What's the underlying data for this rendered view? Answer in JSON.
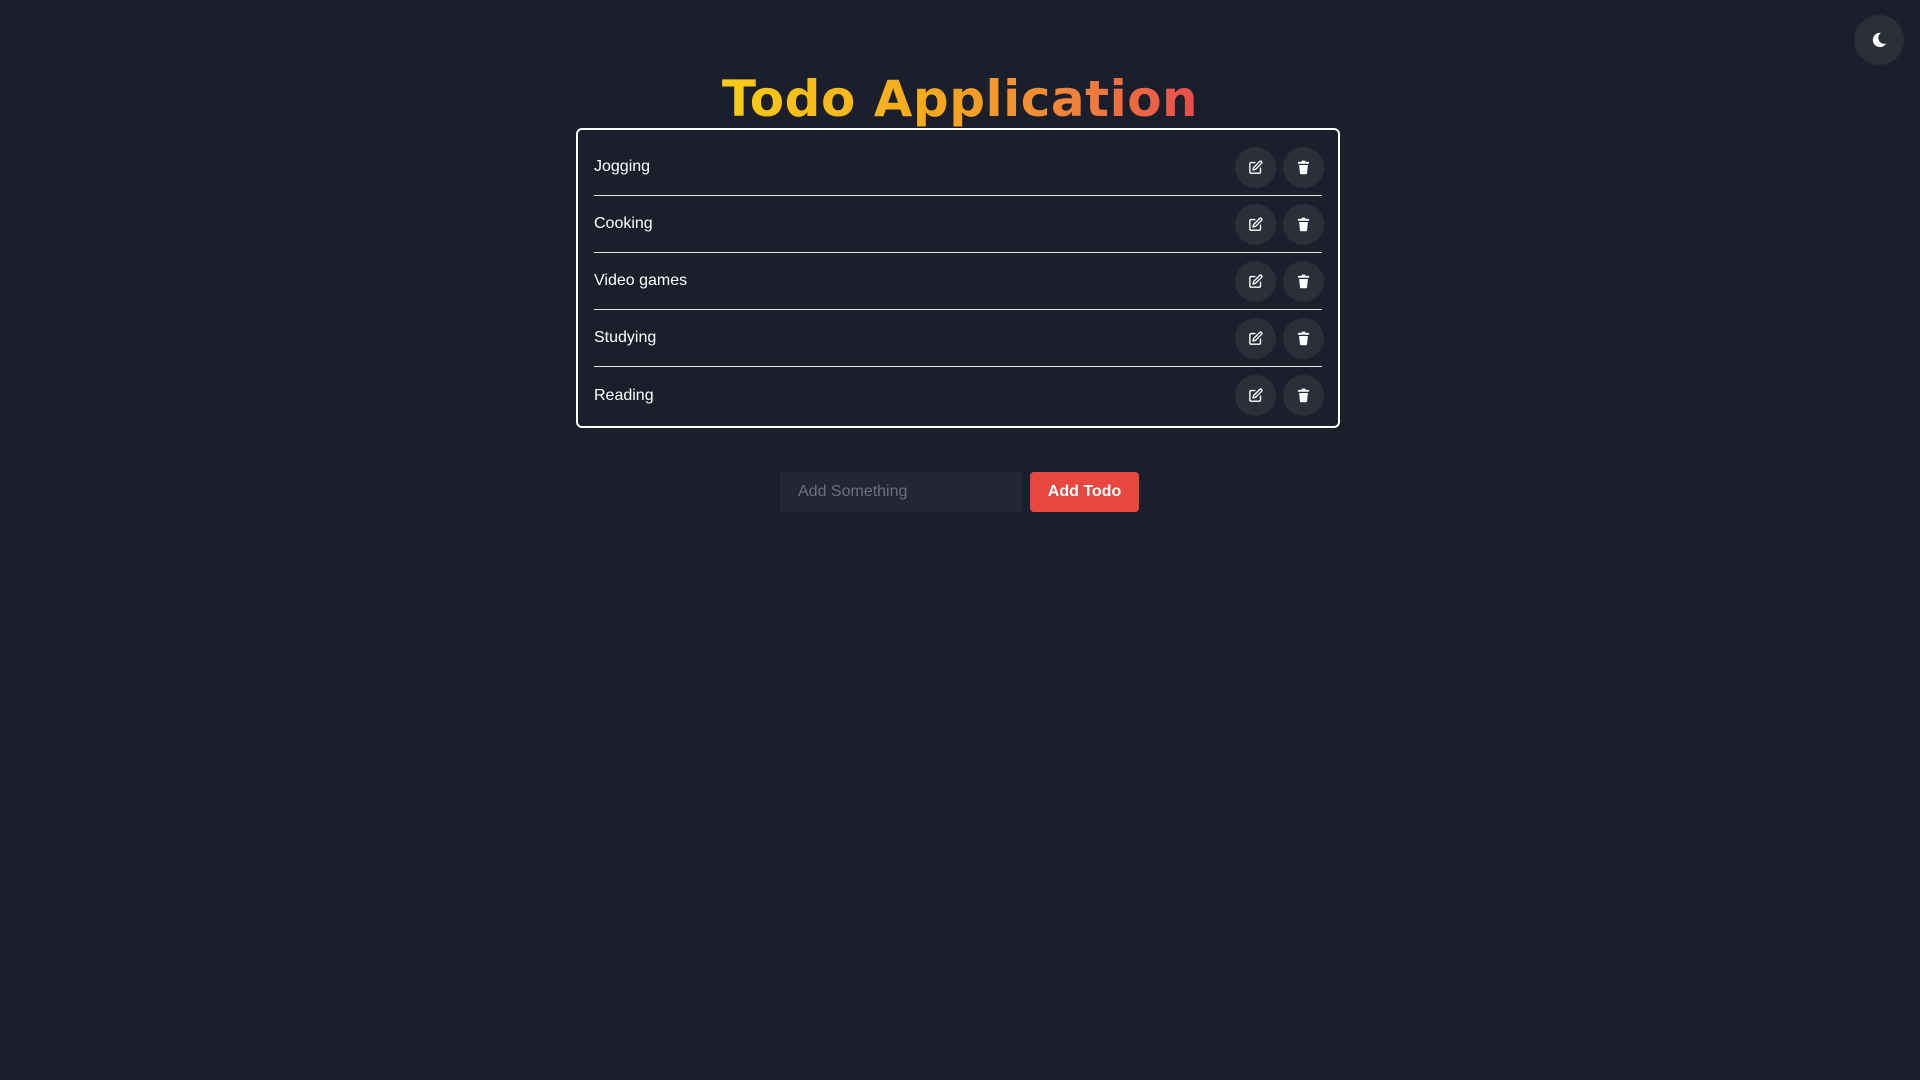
{
  "header": {
    "title_part1": "Todo",
    "title_part2": "Application"
  },
  "theme_toggle": {
    "icon": "moon-icon"
  },
  "todos": [
    {
      "text": "Jogging"
    },
    {
      "text": "Cooking"
    },
    {
      "text": "Video games"
    },
    {
      "text": "Studying"
    },
    {
      "text": "Reading"
    }
  ],
  "row_actions": {
    "edit_icon": "edit-icon",
    "delete_icon": "trash-icon"
  },
  "add_form": {
    "placeholder": "Add Something",
    "value": "",
    "button_label": "Add Todo"
  },
  "colors": {
    "background": "#1b1f2b",
    "accent_button": "#e8473f",
    "title_gradient": [
      "#facc15",
      "#f7a81e",
      "#f0813c",
      "#ea4c4c"
    ],
    "icon_button_bg": "#2b2f3a",
    "border": "#ffffff"
  }
}
